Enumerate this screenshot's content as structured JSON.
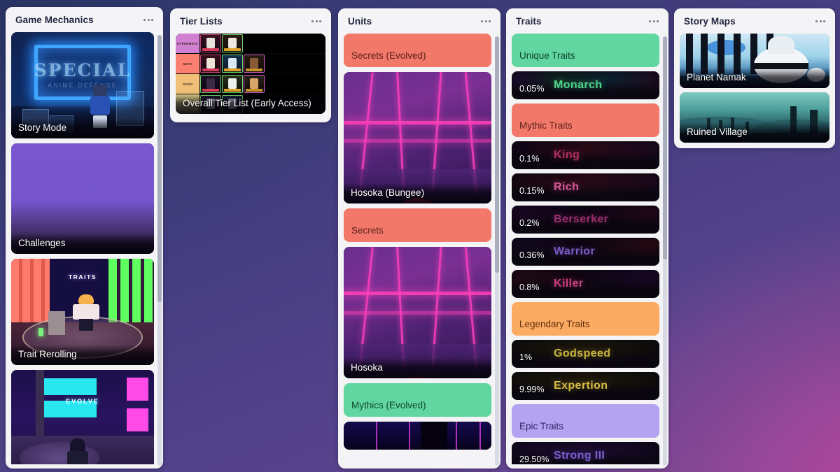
{
  "board": {
    "panels": [
      {
        "id": "game-mechanics",
        "title": "Game Mechanics",
        "menu_icon": "ellipsis-icon",
        "cards": [
          {
            "kind": "image",
            "art": "story",
            "label": "Story Mode"
          },
          {
            "kind": "image",
            "art": "challenges",
            "label": "Challenges"
          },
          {
            "kind": "image",
            "art": "reroll",
            "label": "Trait Rerolling"
          },
          {
            "kind": "image",
            "art": "evolve",
            "label": ""
          }
        ]
      },
      {
        "id": "tier-lists",
        "title": "Tier Lists",
        "menu_icon": "ellipsis-icon",
        "cards": [
          {
            "kind": "image",
            "art": "tier",
            "label": "Overall Tier List (Early Access)"
          }
        ],
        "tier_rows": [
          "HYPERMETA",
          "META",
          "GOOD",
          "MID"
        ]
      },
      {
        "id": "units",
        "title": "Units",
        "menu_icon": "ellipsis-icon",
        "cards": [
          {
            "kind": "chip",
            "label": "Secrets (Evolved)",
            "bg": "#f2796a",
            "fg": "#5c1f1a"
          },
          {
            "kind": "image",
            "art": "hosoka",
            "label": "Hosoka (Bungee)"
          },
          {
            "kind": "chip",
            "label": "Secrets",
            "bg": "#f2796a",
            "fg": "#5c1f1a"
          },
          {
            "kind": "image",
            "art": "hosoka",
            "label": "Hosoka"
          },
          {
            "kind": "chip",
            "label": "Mythics (Evolved)",
            "bg": "#61d6a0",
            "fg": "#0f4632"
          },
          {
            "kind": "image",
            "art": "mythic",
            "label": ""
          }
        ]
      },
      {
        "id": "traits",
        "title": "Traits",
        "menu_icon": "ellipsis-icon",
        "cards": [
          {
            "kind": "chip",
            "label": "Unique Traits",
            "bg": "#61d6a0",
            "fg": "#0f4632"
          },
          {
            "kind": "trait",
            "pct": "0.05%",
            "name": "Monarch",
            "color": "#4fd48a",
            "glow": "linear-gradient(90deg,#2b0d4e,#123f2b,#0d3a4e,#3a0f2e)"
          },
          {
            "kind": "chip",
            "label": "Mythic Traits",
            "bg": "#f2796a",
            "fg": "#5c1f1a"
          },
          {
            "kind": "trait",
            "pct": "0.1%",
            "name": "King",
            "color": "#b03060",
            "glow": "linear-gradient(90deg,#13041a,#4a0f1c,#2a0a2e)"
          },
          {
            "kind": "trait",
            "pct": "0.15%",
            "name": "Rich",
            "color": "#d9589a",
            "glow": "linear-gradient(90deg,#2a0812,#470f1c,#2b0a28)"
          },
          {
            "kind": "trait",
            "pct": "0.2%",
            "name": "Berserker",
            "color": "#9b2f6e",
            "glow": "linear-gradient(90deg,#2b0836,#120418,#3a0a22)"
          },
          {
            "kind": "trait",
            "pct": "0.36%",
            "name": "Warrior",
            "color": "#7b58c4",
            "glow": "linear-gradient(90deg,#1a0a2e,#120612,#4a1018)"
          },
          {
            "kind": "trait",
            "pct": "0.8%",
            "name": "Killer",
            "color": "#c8417f",
            "glow": "linear-gradient(90deg,#3a0e14,#140618,#2a0a3e)"
          },
          {
            "kind": "chip",
            "label": "Legendary Traits",
            "bg": "#fcab63",
            "fg": "#60300c"
          },
          {
            "kind": "trait",
            "pct": "1%",
            "name": "Godspeed",
            "color": "#c7b23f",
            "glow": "linear-gradient(90deg,#161405,#2a2608,#111005)"
          },
          {
            "kind": "trait",
            "pct": "9.99%",
            "name": "Expertion",
            "color": "#d4bb46",
            "glow": "linear-gradient(90deg,#1a1705,#2e2808,#141104)"
          },
          {
            "kind": "chip",
            "label": "Epic Traits",
            "bg": "#b3a3f0",
            "fg": "#2e2468"
          },
          {
            "kind": "trait",
            "pct": "29.50%",
            "name": "Strong III",
            "color": "#7b5ed0",
            "glow": "linear-gradient(90deg,#1c0a34,#2c1048,#160828)"
          }
        ]
      },
      {
        "id": "story-maps",
        "title": "Story Maps",
        "menu_icon": "ellipsis-icon",
        "cards": [
          {
            "kind": "image",
            "art": "namak",
            "label": "Planet Namak"
          },
          {
            "kind": "image",
            "art": "village",
            "label": "Ruined Village"
          }
        ]
      }
    ]
  },
  "theme": {
    "panel_bg": "#f4f4f6",
    "title_color": "#22253f",
    "scrollbar_track": "#d7dae2",
    "scrollbar_thumb": "#a9adbd"
  }
}
